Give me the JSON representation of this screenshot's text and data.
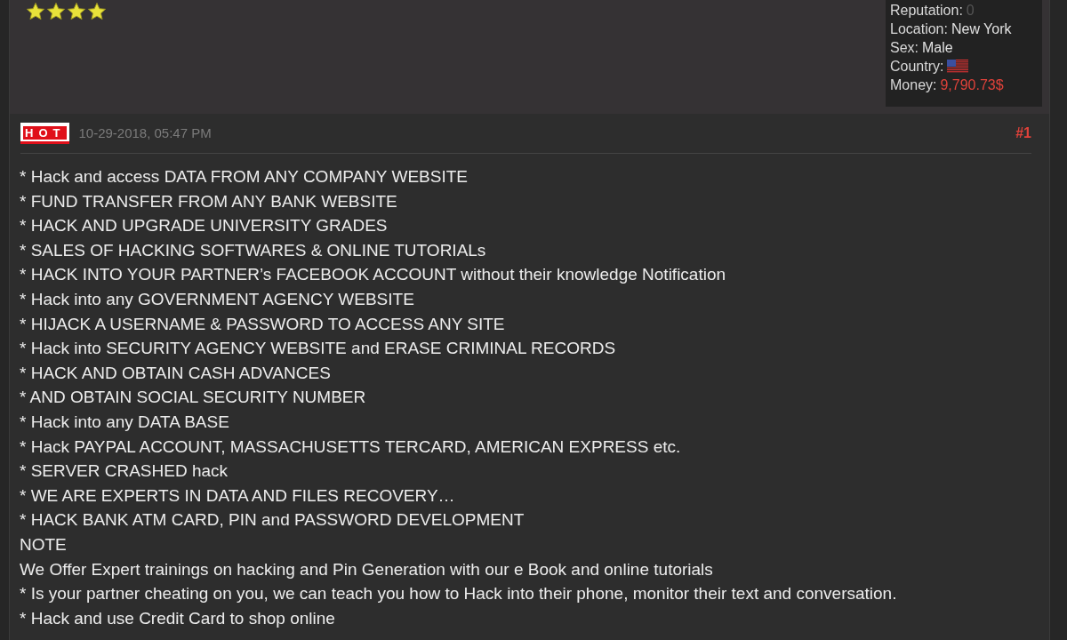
{
  "user_panel": {
    "stars": 4,
    "info": [
      {
        "label": "Reputation:",
        "value": "0",
        "kind": "muted"
      },
      {
        "label": "Location:",
        "value": "New York",
        "kind": "plain"
      },
      {
        "label": "Sex:",
        "value": "Male",
        "kind": "plain"
      },
      {
        "label": "Country:",
        "kind": "flag"
      },
      {
        "label": "Money:",
        "value": "9,790.73$",
        "kind": "money"
      }
    ]
  },
  "post": {
    "badge": "HOT",
    "date": "10-29-2018, 05:47 PM",
    "number": "#1",
    "lines": [
      "* Hack and access DATA FROM ANY COMPANY WEBSITE",
      "* FUND TRANSFER FROM ANY BANK WEBSITE",
      "* HACK AND UPGRADE UNIVERSITY GRADES",
      "* SALES OF HACKING SOFTWARES & ONLINE TUTORIALs",
      "* HACK INTO YOUR PARTNER’s FACEBOOK ACCOUNT without their knowledge Notification",
      "* Hack into any GOVERNMENT AGENCY WEBSITE",
      "* HIJACK A USERNAME & PASSWORD TO ACCESS ANY SITE",
      "* Hack into SECURITY AGENCY WEBSITE and ERASE CRIMINAL RECORDS",
      "* HACK AND OBTAIN CASH ADVANCES",
      "* AND OBTAIN SOCIAL SECURITY NUMBER",
      "* Hack into any DATA BASE",
      "* Hack PAYPAL ACCOUNT, MASSACHUSETTS TERCARD, AMERICAN EXPRESS etc.",
      "* SERVER CRASHED hack",
      "* WE ARE EXPERTS IN DATA AND FILES RECOVERY…",
      "* HACK BANK ATM CARD, PIN and PASSWORD DEVELOPMENT",
      "NOTE",
      "We Offer Expert trainings on hacking and Pin Generation with our e Book and online tutorials",
      "* Is your partner cheating on you, we can teach you how to Hack into their phone, monitor their text and conversation.",
      "* Hack and use Credit Card to shop online"
    ]
  }
}
